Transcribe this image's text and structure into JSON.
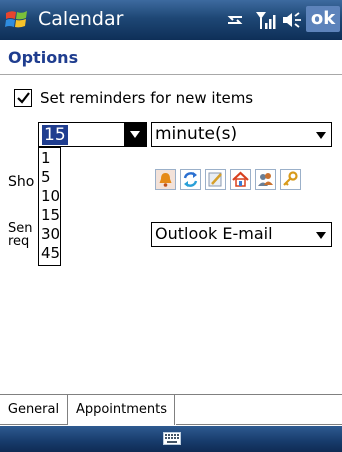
{
  "titlebar": {
    "title": "Calendar",
    "ok_label": "ok",
    "icons": [
      "windows-start-icon",
      "connectivity-icon",
      "signal-icon",
      "volume-icon"
    ]
  },
  "page": {
    "header": "Options"
  },
  "reminder": {
    "checkbox_checked": true,
    "label": "Set reminders for new items",
    "amount_value": "15",
    "unit_value": "minute(s)",
    "amount_options": [
      "1",
      "5",
      "10",
      "15",
      "30",
      "45"
    ]
  },
  "left_labels": {
    "show_label_fragment": "Sho",
    "send_label_fragment_1": "Sen",
    "send_label_fragment_2": "req"
  },
  "category_icons": [
    "bell-icon",
    "recurrence-icon",
    "note-icon",
    "home-icon",
    "people-icon",
    "key-icon"
  ],
  "send_via": {
    "value": "Outlook E-mail"
  },
  "tabs": [
    {
      "label": "General",
      "active": false
    },
    {
      "label": "Appointments",
      "active": true
    }
  ],
  "bottombar": {
    "icon": "keyboard-icon"
  },
  "colors": {
    "titlebar": "#1e4775",
    "header_text": "#1f3d8f",
    "selection": "#1f3d8f"
  }
}
